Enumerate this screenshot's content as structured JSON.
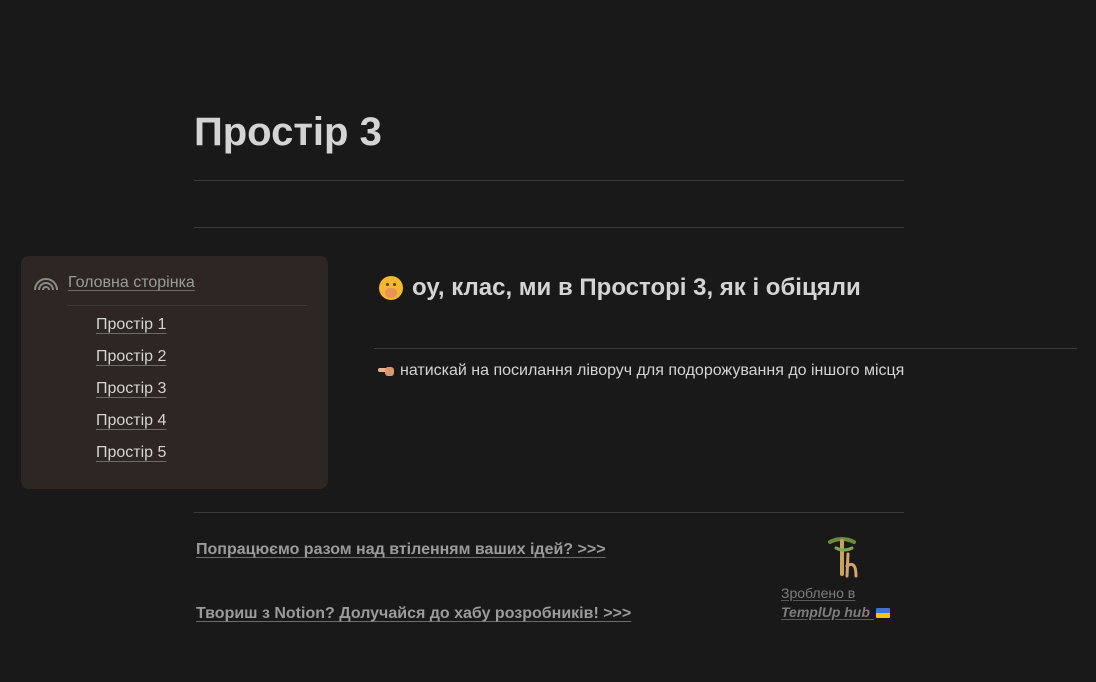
{
  "page": {
    "title": "Простір 3"
  },
  "sidebar": {
    "home": {
      "label": "Головна сторінка",
      "icon": "rainbow-icon"
    },
    "items": [
      {
        "label": "Простір 1"
      },
      {
        "label": "Простір 2"
      },
      {
        "label": "Простір 3"
      },
      {
        "label": "Простір 4"
      },
      {
        "label": "Простір 5"
      }
    ]
  },
  "main": {
    "heading": "оу, клас, ми в Просторі 3, як і обіцяли",
    "heading_icon": "shushing-face-icon",
    "hint": "натискай на посилання ліворуч для подорожування до іншого місця",
    "hint_icon": "pointing-left-icon"
  },
  "footer": {
    "link1": "Попрацюємо разом над втіленням ваших ідей? >>>",
    "link2": "Твориш з Notion? Долучайся до хабу розробників! >>>",
    "made_in": "Зроблено в ",
    "brand": "TemplUp hub ",
    "logo_icon": "templup-logo-icon",
    "flag_icon": "ukraine-flag-icon"
  },
  "colors": {
    "background": "#191919",
    "sidebar_bg": "#2e2622",
    "text": "#d4d4d4",
    "muted": "#9b9b9b"
  }
}
